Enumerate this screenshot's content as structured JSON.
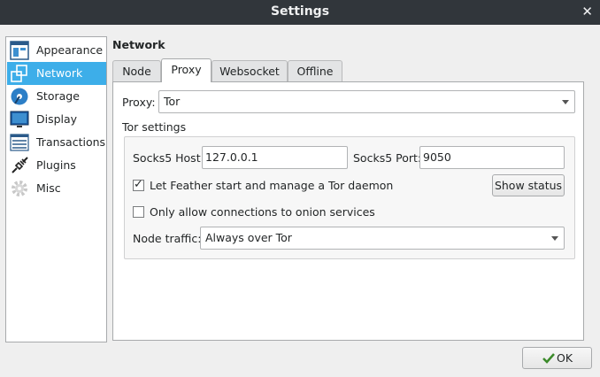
{
  "window": {
    "title": "Settings",
    "close_glyph": "✕"
  },
  "sidebar": {
    "items": [
      {
        "label": "Appearance",
        "icon": "appearance-icon",
        "selected": false
      },
      {
        "label": "Network",
        "icon": "network-icon",
        "selected": true
      },
      {
        "label": "Storage",
        "icon": "storage-icon",
        "selected": false
      },
      {
        "label": "Display",
        "icon": "display-icon",
        "selected": false
      },
      {
        "label": "Transactions",
        "icon": "transactions-icon",
        "selected": false
      },
      {
        "label": "Plugins",
        "icon": "plugins-icon",
        "selected": false
      },
      {
        "label": "Misc",
        "icon": "gear-icon",
        "selected": false
      }
    ]
  },
  "main": {
    "title": "Network",
    "tabs": [
      {
        "label": "Node",
        "active": false
      },
      {
        "label": "Proxy",
        "active": true
      },
      {
        "label": "Websocket",
        "active": false
      },
      {
        "label": "Offline",
        "active": false
      }
    ],
    "proxy": {
      "label": "Proxy:",
      "value": "Tor"
    },
    "tor": {
      "title": "Tor settings",
      "host_label": "Socks5 Host:",
      "host_value": "127.0.0.1",
      "port_label": "Socks5 Port:",
      "port_value": "9050",
      "manage_label": "Let Feather start and manage a Tor daemon",
      "manage_checked": true,
      "show_status_label": "Show status",
      "onion_label": "Only allow connections to onion services",
      "onion_checked": false,
      "traffic_label": "Node traffic:",
      "traffic_value": "Always over Tor"
    }
  },
  "footer": {
    "ok_label": "OK"
  },
  "colors": {
    "accent": "#3daee9",
    "titlebar": "#31363b"
  }
}
